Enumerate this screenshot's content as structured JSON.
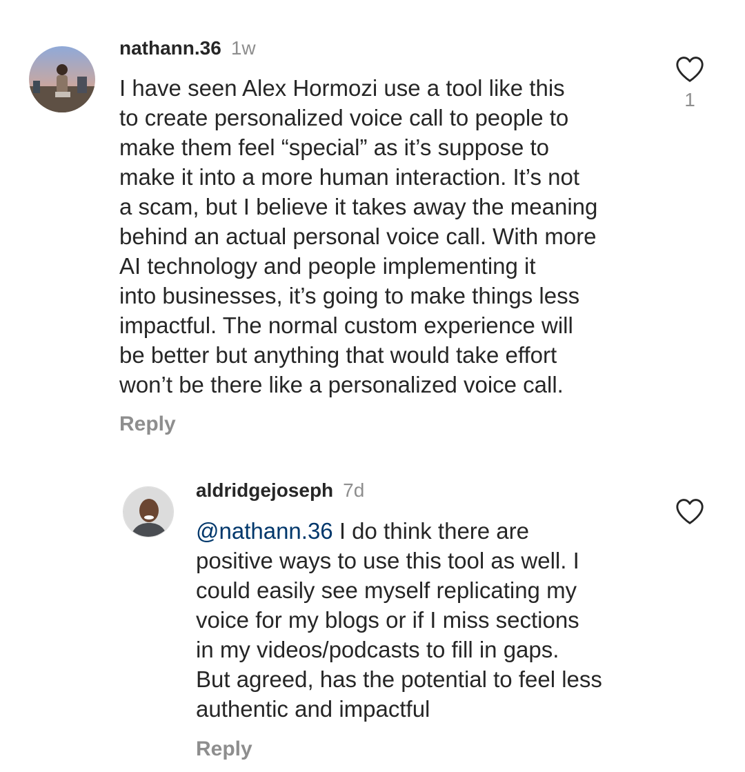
{
  "comments": [
    {
      "username": "nathann.36",
      "time": "1w",
      "lines": [
        "I have seen Alex Hormozi use a tool like this",
        "to create personalized voice call to people to",
        "make them feel “special” as it’s suppose to",
        "make it into a more human interaction. It’s not",
        "a scam, but I believe it takes away the meaning",
        "behind an actual personal voice call. With more",
        "AI technology and people implementing it",
        "into businesses, it’s going to make things less",
        "impactful. The normal custom experience will",
        "be better but anything that would take effort",
        "won’t be there like a personalized voice call."
      ],
      "reply_label": "Reply",
      "like_icon": "heart-outline-icon",
      "like_count": "1"
    },
    {
      "username": "aldridgejoseph",
      "time": "7d",
      "mention": "@nathann.36",
      "lines": [
        " I do think there are",
        "positive ways to use this tool as well. I",
        "could easily see myself replicating my",
        "voice for my blogs or if I miss sections",
        "in my videos/podcasts to fill in gaps.",
        "But agreed, has the potential to feel less",
        "authentic and impactful"
      ],
      "reply_label": "Reply",
      "like_icon": "heart-outline-icon"
    }
  ],
  "colors": {
    "text": "#262626",
    "muted": "#8e8e8e",
    "mention": "#00376b",
    "background": "#ffffff"
  }
}
